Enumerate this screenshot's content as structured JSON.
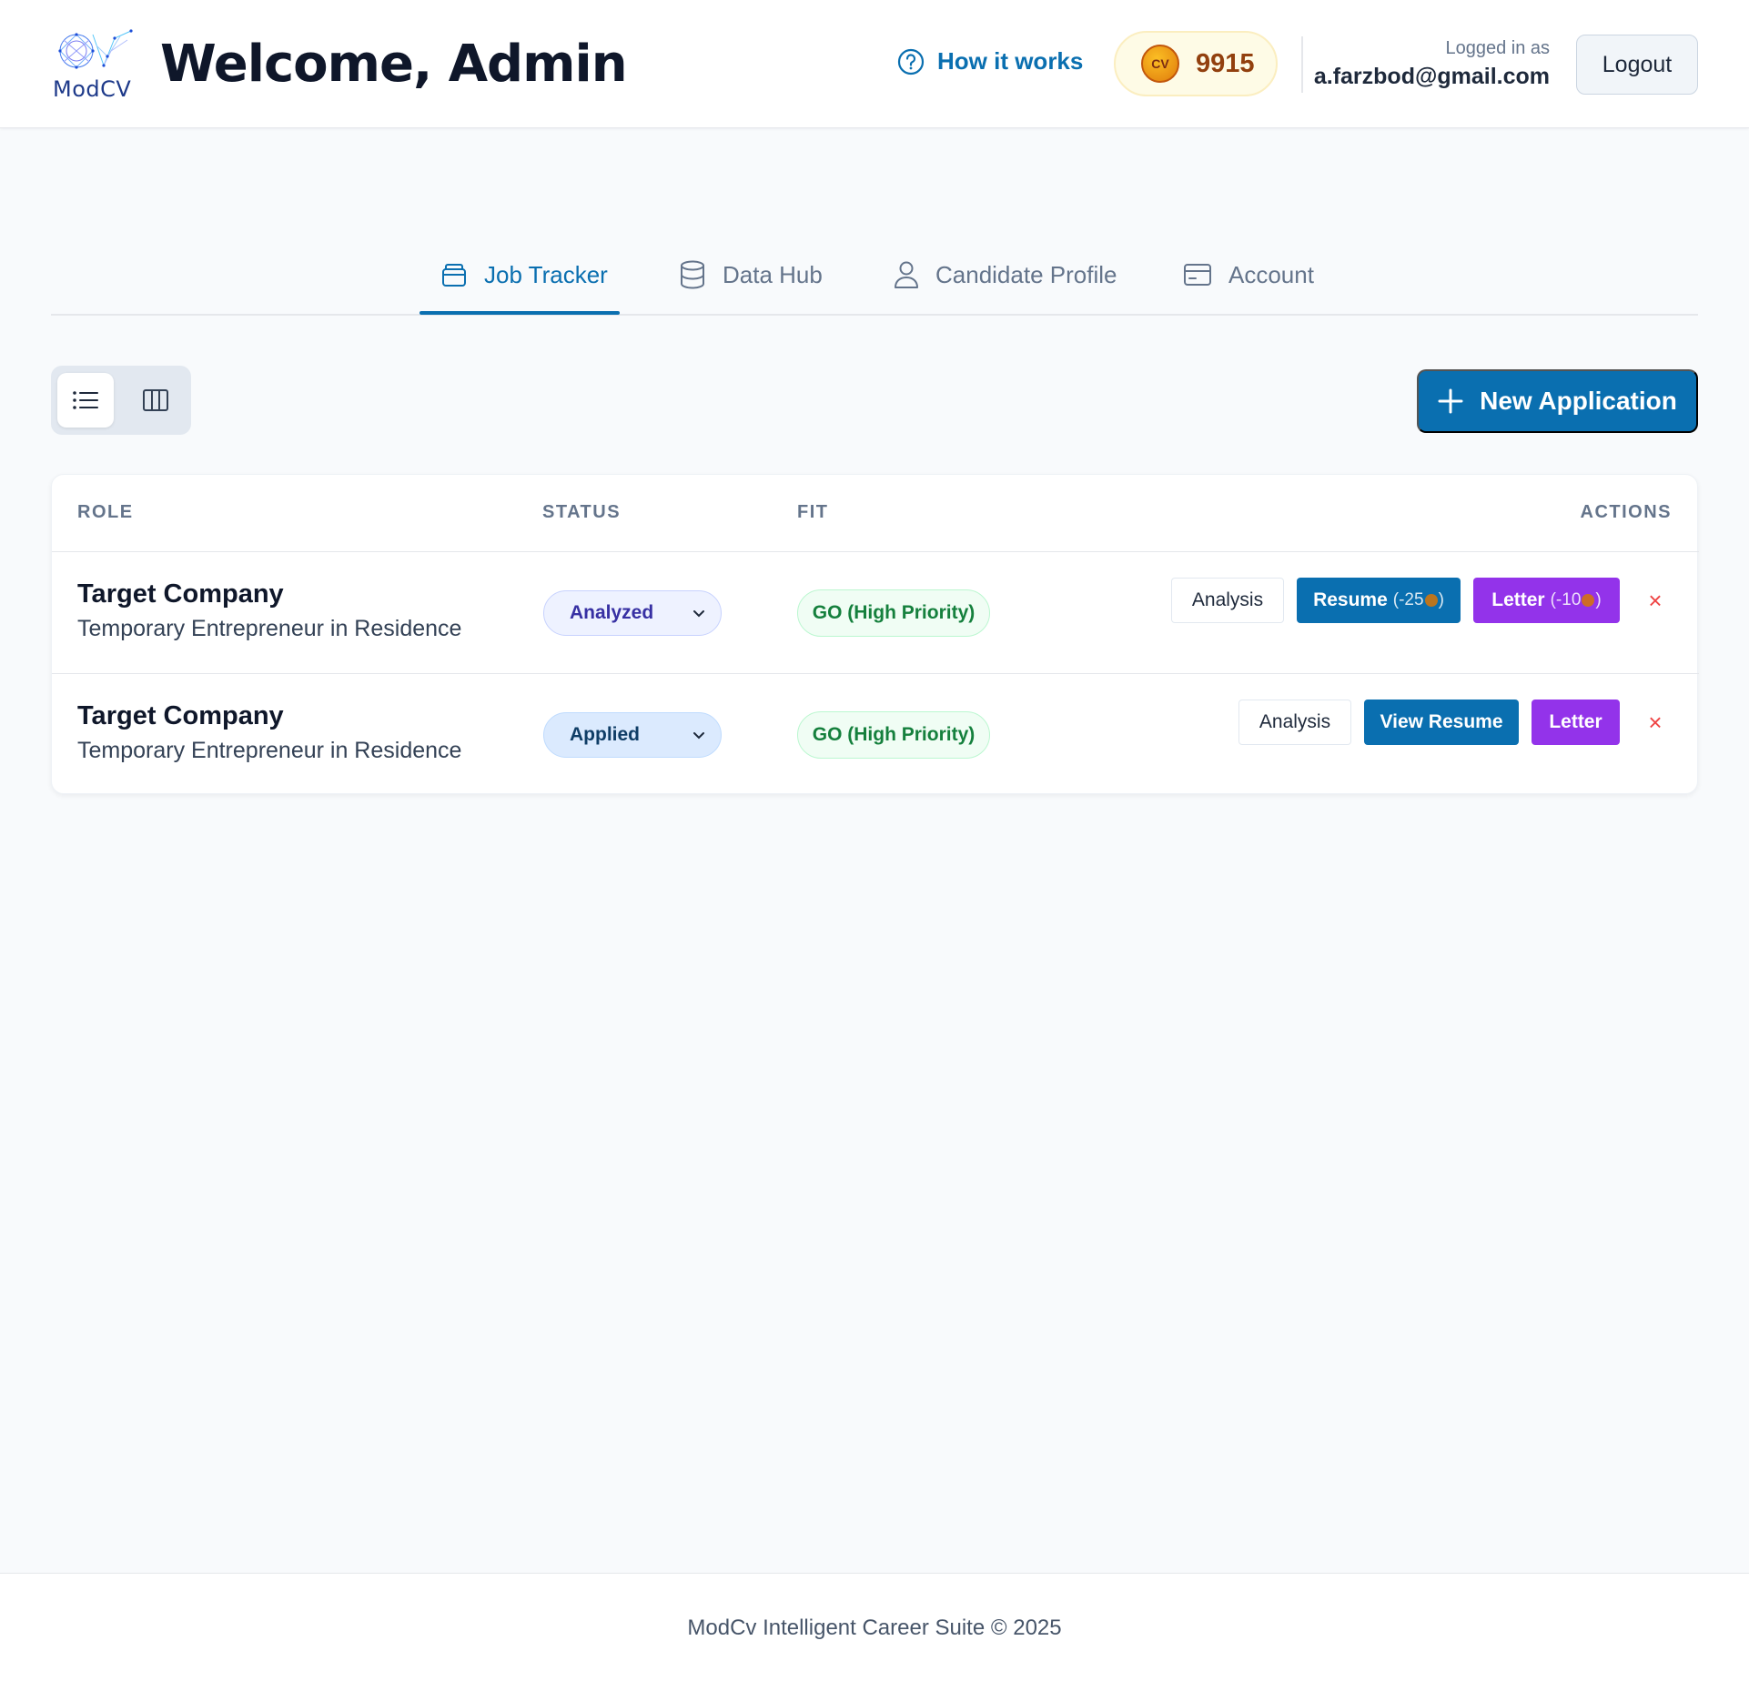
{
  "header": {
    "logo_text": "ModCV",
    "welcome": "Welcome, Admin",
    "how_it_works": "How it works",
    "coin_symbol": "CV",
    "coins": "9915",
    "logged_in_label": "Logged in as",
    "email": "a.farzbod@gmail.com",
    "logout": "Logout"
  },
  "tabs": [
    {
      "label": "Job Tracker",
      "icon": "folder-stack-icon",
      "active": true
    },
    {
      "label": "Data Hub",
      "icon": "database-icon",
      "active": false
    },
    {
      "label": "Candidate Profile",
      "icon": "user-icon",
      "active": false
    },
    {
      "label": "Account",
      "icon": "credit-card-icon",
      "active": false
    }
  ],
  "toolbar": {
    "views": [
      "list-view-icon",
      "board-view-icon"
    ],
    "active_view": "list",
    "new_application": "New Application"
  },
  "table": {
    "columns": [
      "ROLE",
      "STATUS",
      "FIT",
      "ACTIONS"
    ],
    "rows": [
      {
        "company": "Target Company",
        "role": "Temporary Entrepreneur in Residence",
        "status": "Analyzed",
        "fit": "GO (High Priority)",
        "analysis": "Analysis",
        "resume": "Resume",
        "resume_cost": "(-25",
        "letter": "Letter",
        "letter_cost": "(-10",
        "cost_close": ")",
        "delete": "×"
      },
      {
        "company": "Target Company",
        "role": "Temporary Entrepreneur in Residence",
        "status": "Applied",
        "fit": "GO (High Priority)",
        "analysis": "Analysis",
        "resume": "View Resume",
        "letter": "Letter",
        "delete": "×"
      }
    ]
  },
  "footer": {
    "text": "ModCv Intelligent Career Suite © 2025"
  },
  "colors": {
    "primary": "#0a6fb0",
    "purple": "#9333ea",
    "go_green": "#15803d",
    "danger": "#ef4444"
  }
}
